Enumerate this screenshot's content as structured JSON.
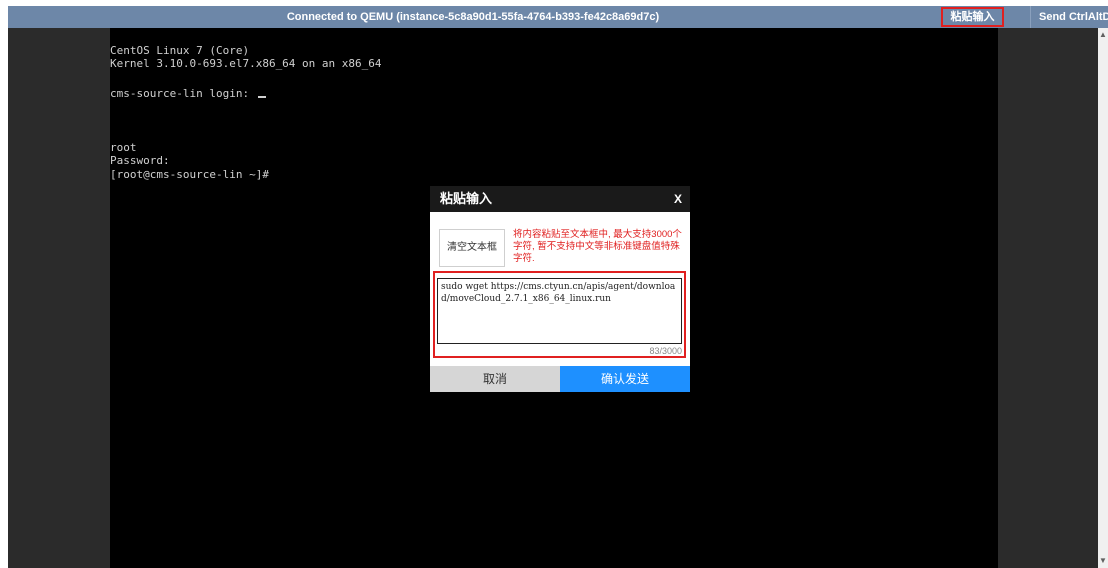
{
  "topbar": {
    "title": "Connected to QEMU (instance-5c8a90d1-55fa-4764-b393-fe42c8a69d7c)",
    "paste_label": "粘贴输入",
    "send_cad_label": "Send CtrlAltDel"
  },
  "terminal": {
    "lines": [
      "CentOS Linux 7 (Core)",
      "Kernel 3.10.0-693.el7.x86_64 on an x86_64",
      "cms-source-lin login: ",
      "root",
      "Password:",
      "[root@cms-source-lin ~]#"
    ]
  },
  "dialog": {
    "title": "粘贴输入",
    "close_label": "X",
    "clear_label": "清空文本框",
    "hint": "将内容粘贴至文本框中, 最大支持3000个字符, 暂不支持中文等非标准键盘值特殊字符.",
    "text_value": "sudo wget https://cms.ctyun.cn/apis/agent/download/moveCloud_2.7.1_x86_64_linux.run",
    "counter": "83/3000",
    "cancel_label": "取消",
    "confirm_label": "确认发送"
  },
  "colors": {
    "topbar": "#6d87a8",
    "highlight": "#e02020",
    "confirm": "#1e90ff",
    "screen": "#000000"
  },
  "icons": {
    "scroll_up": "arrow-up-icon",
    "scroll_down": "arrow-down-icon"
  }
}
